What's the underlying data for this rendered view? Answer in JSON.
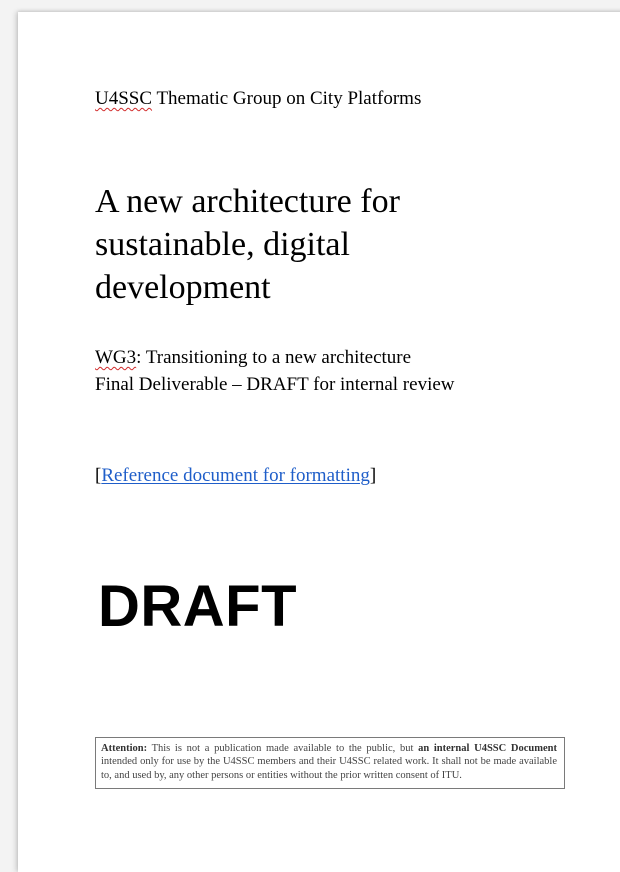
{
  "header": {
    "group_prefix": "U4SSC",
    "group_suffix": " Thematic Group on City Platforms"
  },
  "title": "A new architecture for sustainable, digital development",
  "subtitle": {
    "wg_prefix": "WG3",
    "wg_suffix": ": Transitioning to a new architecture",
    "deliverable": "Final Deliverable – DRAFT for internal review"
  },
  "reference": {
    "open_bracket": "[",
    "link_text": "Reference document for formatting",
    "close_bracket": "]"
  },
  "watermark": "DRAFT",
  "notice": {
    "label": "Attention:",
    "text_1": " This is not a publication made available to the public, but ",
    "bold_1": "an internal U4SSC Document",
    "text_2": " intended only for use by the U4SSC members and their U4SSC related work. It shall not be made available to, and used by, any other persons or entities without the prior written consent of ITU."
  }
}
